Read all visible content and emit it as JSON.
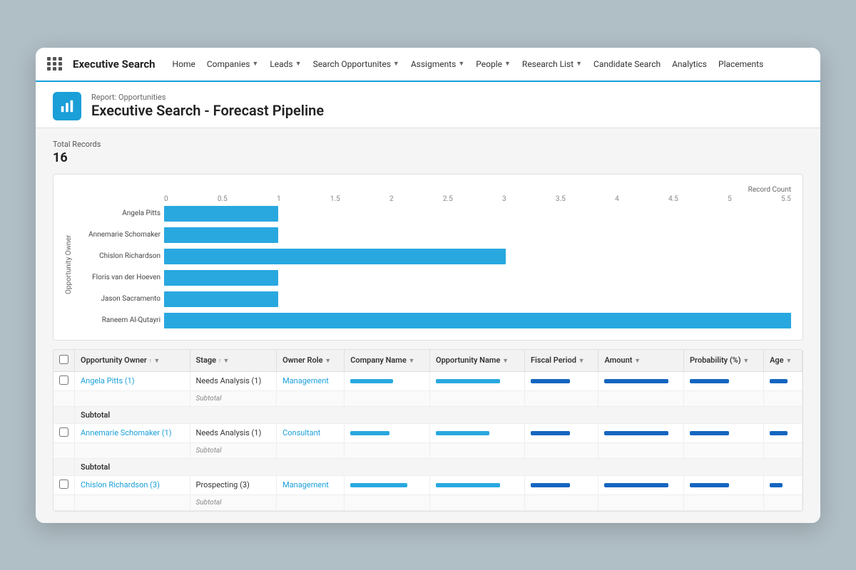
{
  "app": {
    "name": "Executive Search",
    "nav": [
      {
        "label": "Home",
        "has_chevron": false
      },
      {
        "label": "Companies",
        "has_chevron": true
      },
      {
        "label": "Leads",
        "has_chevron": true
      },
      {
        "label": "Search Opportunites",
        "has_chevron": true
      },
      {
        "label": "Assigments",
        "has_chevron": true
      },
      {
        "label": "People",
        "has_chevron": true
      },
      {
        "label": "Research List",
        "has_chevron": true
      },
      {
        "label": "Candidate Search",
        "has_chevron": false
      },
      {
        "label": "Analytics",
        "has_chevron": false
      },
      {
        "label": "Placements",
        "has_chevron": false
      }
    ]
  },
  "report": {
    "subtitle": "Report: Opportunities",
    "title": "Executive Search - Forecast Pipeline",
    "total_records_label": "Total Records",
    "total_count": "16"
  },
  "chart": {
    "y_axis_label": "Opportunity Owner",
    "record_count_label": "Record Count",
    "x_labels": [
      "0",
      "0.5",
      "1",
      "1.5",
      "2",
      "2.5",
      "3",
      "3.5",
      "4",
      "4.5",
      "5",
      "5.5"
    ],
    "bars": [
      {
        "label": "Angela Pitts",
        "value": 1,
        "max": 5.5
      },
      {
        "label": "Annemarie Schomaker",
        "value": 1,
        "max": 5.5
      },
      {
        "label": "Chislon Richardson",
        "value": 3,
        "max": 5.5
      },
      {
        "label": "Floris van der Hoeven",
        "value": 1,
        "max": 5.5
      },
      {
        "label": "Jason Sacramento",
        "value": 1,
        "max": 5.5
      },
      {
        "label": "Raneem Al-Qutayri",
        "value": 5.5,
        "max": 5.5
      }
    ]
  },
  "table": {
    "columns": [
      {
        "label": "Opportunity Owner",
        "sort": "↑",
        "filter": true
      },
      {
        "label": "Stage",
        "sort": "↑",
        "filter": true
      },
      {
        "label": "Owner Role",
        "filter": true
      },
      {
        "label": "Company Name",
        "filter": true
      },
      {
        "label": "Opportunity Name",
        "filter": true
      },
      {
        "label": "Fiscal Period",
        "filter": true
      },
      {
        "label": "Amount",
        "filter": true
      },
      {
        "label": "Probability (%)",
        "filter": true
      },
      {
        "label": "Age",
        "filter": true
      }
    ],
    "rows": [
      {
        "type": "data",
        "owner": "Angela Pitts (1)",
        "stage": "Needs Analysis (1)",
        "owner_role": "Management",
        "company_bar": 60,
        "opp_bar": 90,
        "fiscal_bar": 55,
        "amount_bar": 110,
        "prob_bar": 70,
        "age_bar": 30
      },
      {
        "type": "subtotal",
        "label": "Subtotal"
      },
      {
        "type": "group",
        "label": "Subtotal"
      },
      {
        "type": "data",
        "owner": "Annemarie Schomaker (1)",
        "stage": "Needs Analysis (1)",
        "owner_role": "Consultant",
        "company_bar": 55,
        "opp_bar": 75,
        "fiscal_bar": 55,
        "amount_bar": 110,
        "prob_bar": 70,
        "age_bar": 30
      },
      {
        "type": "subtotal",
        "label": "Subtotal"
      },
      {
        "type": "group",
        "label": "Subtotal"
      },
      {
        "type": "data",
        "owner": "Chislon Richardson (3)",
        "stage": "Prospecting (3)",
        "owner_role": "Management",
        "company_bar": 80,
        "opp_bar": 90,
        "fiscal_bar": 55,
        "amount_bar": 110,
        "prob_bar": 70,
        "age_bar": 22
      },
      {
        "type": "subtotal",
        "label": "Subtotal"
      }
    ]
  }
}
